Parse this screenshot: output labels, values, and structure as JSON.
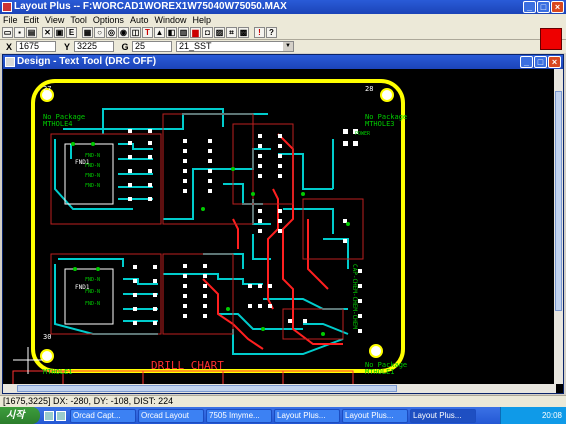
{
  "app": {
    "title": "Layout Plus -- F:WORCAD1WOREX1W75040W75050.MAX",
    "colors": {
      "titlebar": "#1c44b8",
      "board_outline": "#ffff00",
      "trace_cyan": "#00cccc",
      "trace_red": "#ff0000",
      "silkscreen": "#00cc00"
    }
  },
  "menu": [
    "File",
    "Edit",
    "View",
    "Tool",
    "Options",
    "Auto",
    "Window",
    "Help"
  ],
  "toolbar": {
    "icons": [
      "open-icon",
      "save-icon",
      "print-icon",
      "cut-icon",
      "copy-icon",
      "paste-icon",
      "zoom-in-icon",
      "zoom-out-icon",
      "zoom-all-icon",
      "refresh-icon",
      "text-tool-icon",
      "component-icon",
      "pin-icon",
      "pad-icon",
      "trace-icon",
      "via-icon",
      "color-icon",
      "layer-icon",
      "help-icon",
      "stop-icon",
      "reconnect-icon"
    ]
  },
  "coords": {
    "x_label": "X",
    "x_value": "1675",
    "y_label": "Y",
    "y_value": "3225",
    "g_label": "G",
    "g_value": "25",
    "footprint": "21_SST"
  },
  "design_window": {
    "title": "Design - Text Tool (DRC OFF)",
    "labels": {
      "corner_tl": "27",
      "corner_tr": "28",
      "corner_bl": "30",
      "no_package_tl": "No Package",
      "mthole_tl": "MTHOLE4",
      "no_package_tr": "No Package",
      "mthole_tr": "MTHOLE3",
      "no_package_br": "No Package",
      "mthole_br": "MTHOLE1",
      "mthole_bl": "MTHOLE1",
      "drill_chart": "DRILL CHART",
      "fnd1": "FND1",
      "fnd2": "FND1",
      "fnd_top_lines": [
        "FND-N",
        "FND-N",
        "FND-N",
        "FND-N"
      ],
      "fnd_bottom_lines": [
        "FND-N",
        "FND-N",
        "FND-N"
      ],
      "cap_label": "CAP-CHEM-CHEM-CHEM",
      "power_label": "POWER"
    }
  },
  "statusbar": {
    "text": "[1675,3225] DX: -280, DY: -108, DIST: 224"
  },
  "taskbar": {
    "start": "시작",
    "tasks": [
      "Orcad Capt...",
      "Orcad Layout",
      "7505 Imyme...",
      "Layout Plus...",
      "Layout Plus...",
      "Layout Plus..."
    ],
    "clock": "20:08"
  }
}
